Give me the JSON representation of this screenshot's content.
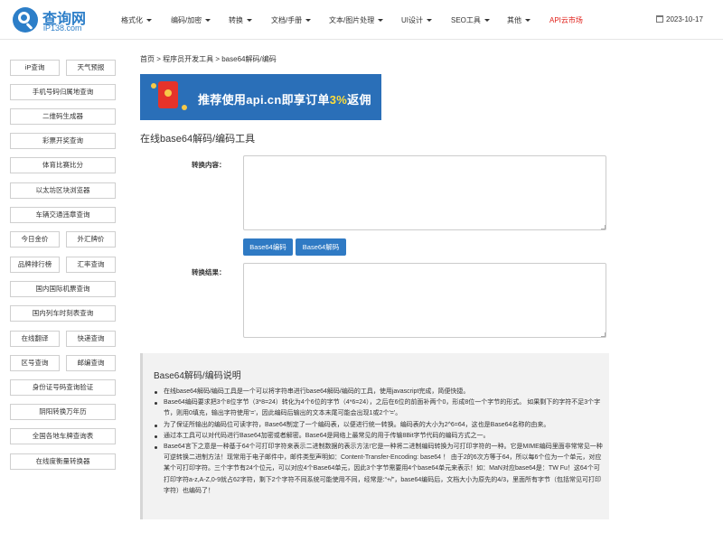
{
  "header": {
    "logo_title": "查询网",
    "logo_sub": "iP138.com",
    "nav": [
      {
        "label": "格式化",
        "has_caret": true
      },
      {
        "label": "编码/加密",
        "has_caret": true
      },
      {
        "label": "转换",
        "has_caret": true
      },
      {
        "label": "文档/手册",
        "has_caret": true
      },
      {
        "label": "文本/图片处理",
        "has_caret": true
      },
      {
        "label": "UI设计",
        "has_caret": true
      },
      {
        "label": "SEO工具",
        "has_caret": true
      },
      {
        "label": "其他",
        "has_caret": true
      },
      {
        "label": "API云市场",
        "has_caret": false
      }
    ],
    "date": "2023-10-17",
    "api_color": "#e0201a"
  },
  "sidebar": {
    "items": [
      "iP查询",
      "天气预报",
      "手机号码归属地查询",
      "二维码生成器",
      "彩票开奖查询",
      "体育比赛比分",
      "以太坊区块浏览器",
      "车辆交通违章查询",
      "今日金价",
      "外汇牌价",
      "品牌排行榜",
      "汇率查询",
      "国内国际机票查询",
      "国内列车时刻表查询",
      "在线翻译",
      "快递查询",
      "区号查询",
      "邮编查询",
      "身份证号码查询验证",
      "阴阳转换万年历",
      "全国各地车牌查询表",
      "在线度衡量转换器"
    ]
  },
  "main": {
    "breadcrumb": "首页 > 程序员开发工具 > base64解码/编码",
    "banner": {
      "prefix": "推荐使用api.cn即享订单",
      "highlight": "3%",
      "suffix": "返佣"
    },
    "title": "在线base64解码/编码工具",
    "input_label": "转换内容：",
    "input_value": "",
    "encode_label": "Base64编码",
    "decode_label": "Base64解码",
    "output_label": "转换结果：",
    "output_value": "",
    "accent": "#2f7ac4",
    "desc_title": "Base64解码/编码说明",
    "desc_items": [
      "在线base64解码/编码工具是一个可以将字符串进行base64解码/编码的工具，使用javascript完成，简便快捷。",
      "Base64编码要求把3个8位字节（3*8=24）转化为4个6位的字节（4*6=24），之后在6位的前面补两个0，形成8位一个字节的形式。 如果剩下的字符不足3个字节，则用0填充，输出字符使用'='，因此编码后输出的文本末尾可能会出现1或2个'='。",
      "为了保证所输出的编码位可读字符，Base64制定了一个编码表，以便进行统一转换。编码表的大小为2^6=64，这也是Base64名称的由来。",
      "通过本工具可以对代码进行Base64加密或者解密。Base64是网络上最常见的用于传输8Bit字节代码的编码方式之一。",
      "Base64言下之意是一种基于64个可打印字符来表示二进制数据的表示方法!它是一种将二进制编码转换为可打印字符的一种。它是MIME编码里面非常常见一种可逆转换二进制方法！现常用于电子邮件中，邮件类型声明如：Content-Transfer-Encoding: base64 ！ 由于2的6次方等于64，所以每6个位为一个单元，对应某个可打印字符。三个字节有24个位元，可以对应4个Base64单元，因此3个字节需要用4个base64单元来表示！如：MaN对应base64是：TW Fu！这64个可打印字符a-z,A-Z,0-9就占62字符，剩下2个字符不同系统可能使用不同，经常是:“+/”，base64编码后，文档大小为原先的4/3，里面所有字节（包括常见可打印字符）也编码了！"
    ]
  }
}
